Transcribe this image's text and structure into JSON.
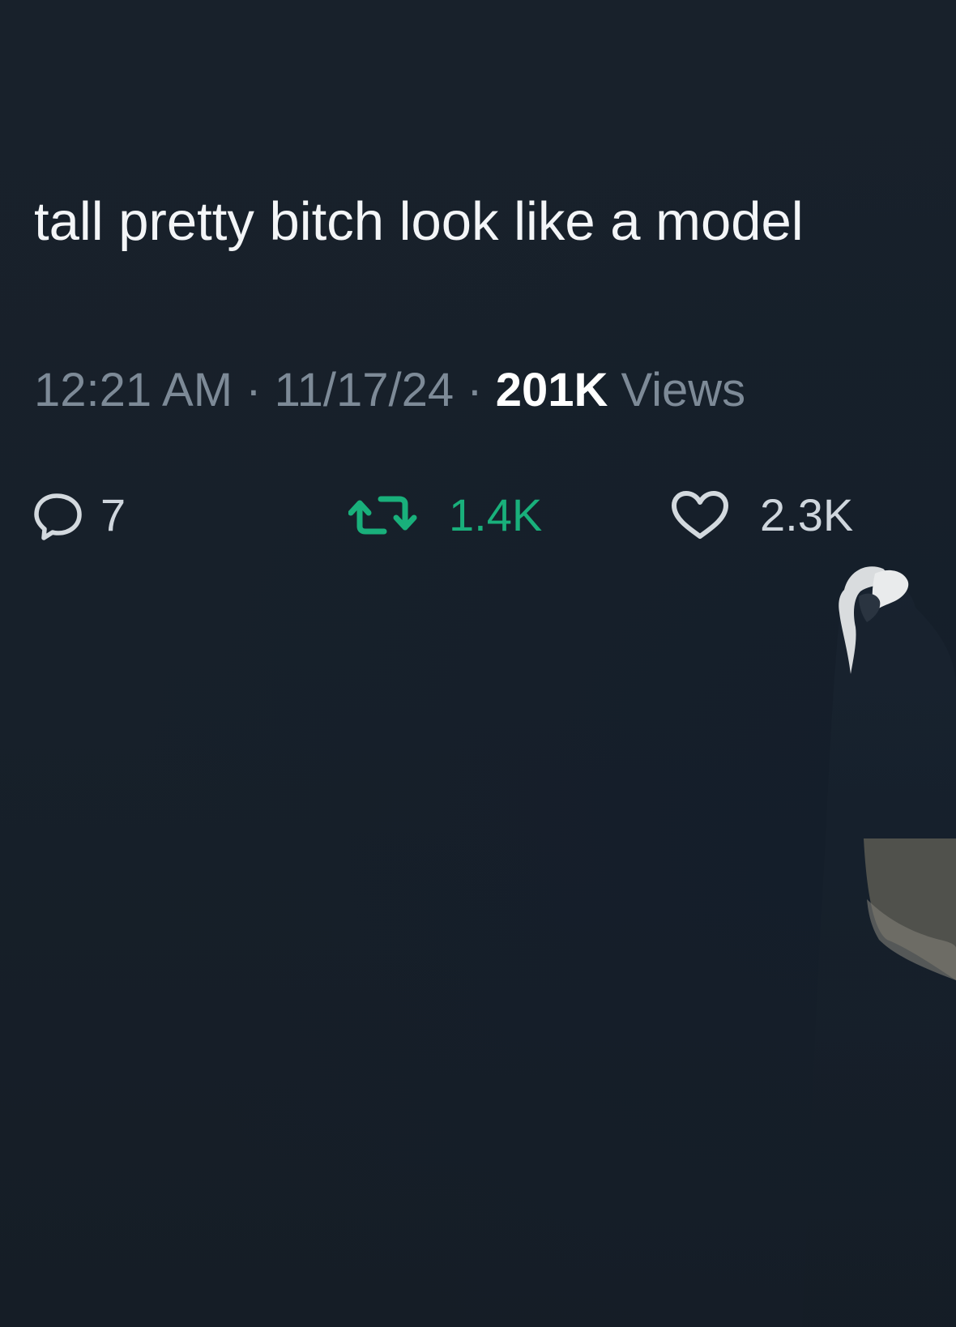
{
  "tweet": {
    "text": "tall pretty bitch look like a model",
    "time": "12:21 AM",
    "separator": "·",
    "date": "11/17/24",
    "views_count": "201K",
    "views_label": "Views"
  },
  "actions": {
    "replies": {
      "icon": "reply-icon",
      "count": "7"
    },
    "retweets": {
      "icon": "retweet-icon",
      "count": "1.4K",
      "color": "#19b07b"
    },
    "likes": {
      "icon": "heart-icon",
      "count": "2.3K"
    }
  },
  "colors": {
    "background": "#17202a",
    "text": "#f3f5f7",
    "muted": "#7d8a97",
    "retweet_active": "#19b07b"
  }
}
